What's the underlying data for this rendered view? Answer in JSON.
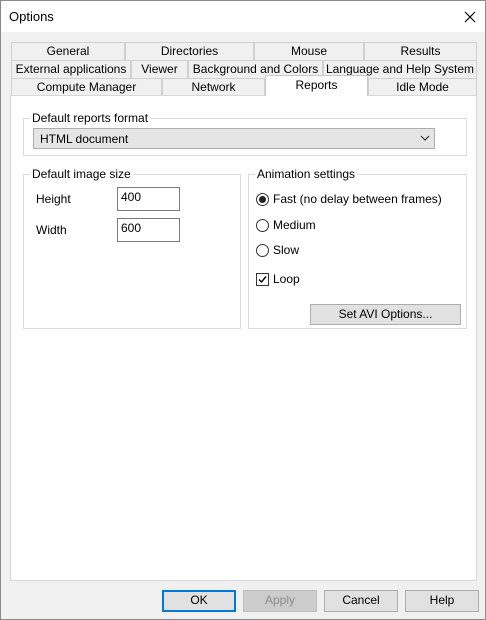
{
  "window": {
    "title": "Options"
  },
  "tabs": {
    "row1": [
      "General",
      "Directories",
      "Mouse",
      "Results"
    ],
    "row2": [
      "External applications",
      "Viewer",
      "Background and Colors",
      "Language and Help System"
    ],
    "row3": [
      "Compute Manager",
      "Network",
      "Reports",
      "Idle Mode"
    ],
    "active": "Reports"
  },
  "reports_format": {
    "legend": "Default reports format",
    "selected": "HTML document"
  },
  "image_size": {
    "legend": "Default image size",
    "height_label": "Height",
    "height_value": "400",
    "width_label": "Width",
    "width_value": "600"
  },
  "animation": {
    "legend": "Animation settings",
    "options": [
      "Fast (no delay between frames)",
      "Medium",
      "Slow"
    ],
    "selected": "Fast (no delay between frames)",
    "loop_label": "Loop",
    "loop_checked": true,
    "avi_button": "Set AVI Options..."
  },
  "footer": {
    "ok": "OK",
    "apply": "Apply",
    "cancel": "Cancel",
    "help": "Help"
  }
}
